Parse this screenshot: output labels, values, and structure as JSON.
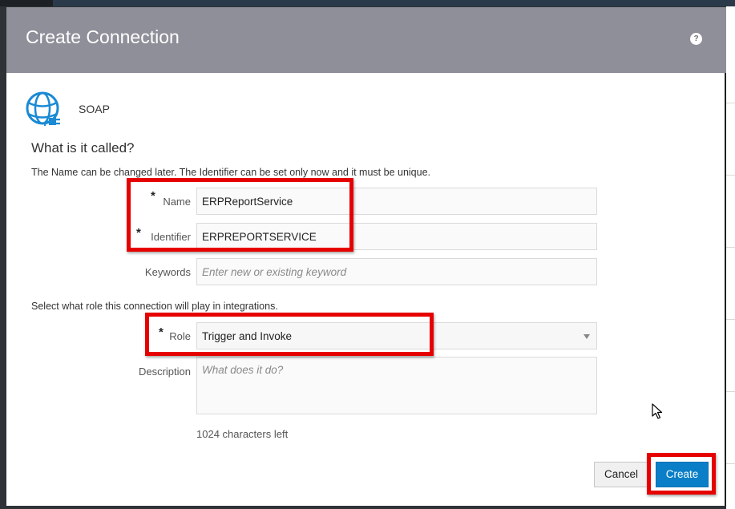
{
  "dialog": {
    "title": "Create Connection",
    "help_glyph": "?"
  },
  "adapter": {
    "label": "SOAP",
    "icon": "soap-adapter-icon"
  },
  "section": {
    "title": "What is it called?",
    "name_hint": "The Name can be changed later. The Identifier can be set only now and it must be unique.",
    "role_hint": "Select what role this connection will play in integrations."
  },
  "form": {
    "name": {
      "label": "Name",
      "required_mark": "*",
      "value": "ERPReportService"
    },
    "identifier": {
      "label": "Identifier",
      "required_mark": "*",
      "value": "ERPREPORTSERVICE"
    },
    "keywords": {
      "label": "Keywords",
      "placeholder": "Enter new or existing keyword"
    },
    "role": {
      "label": "Role",
      "required_mark": "*",
      "selected": "Trigger and Invoke"
    },
    "description": {
      "label": "Description",
      "placeholder": "What does it do?",
      "chars_left": "1024 characters left"
    }
  },
  "buttons": {
    "cancel": "Cancel",
    "create": "Create"
  },
  "colors": {
    "header": "#8e8f99",
    "primary_button": "#0a7ec7",
    "highlight": "#e60000"
  }
}
